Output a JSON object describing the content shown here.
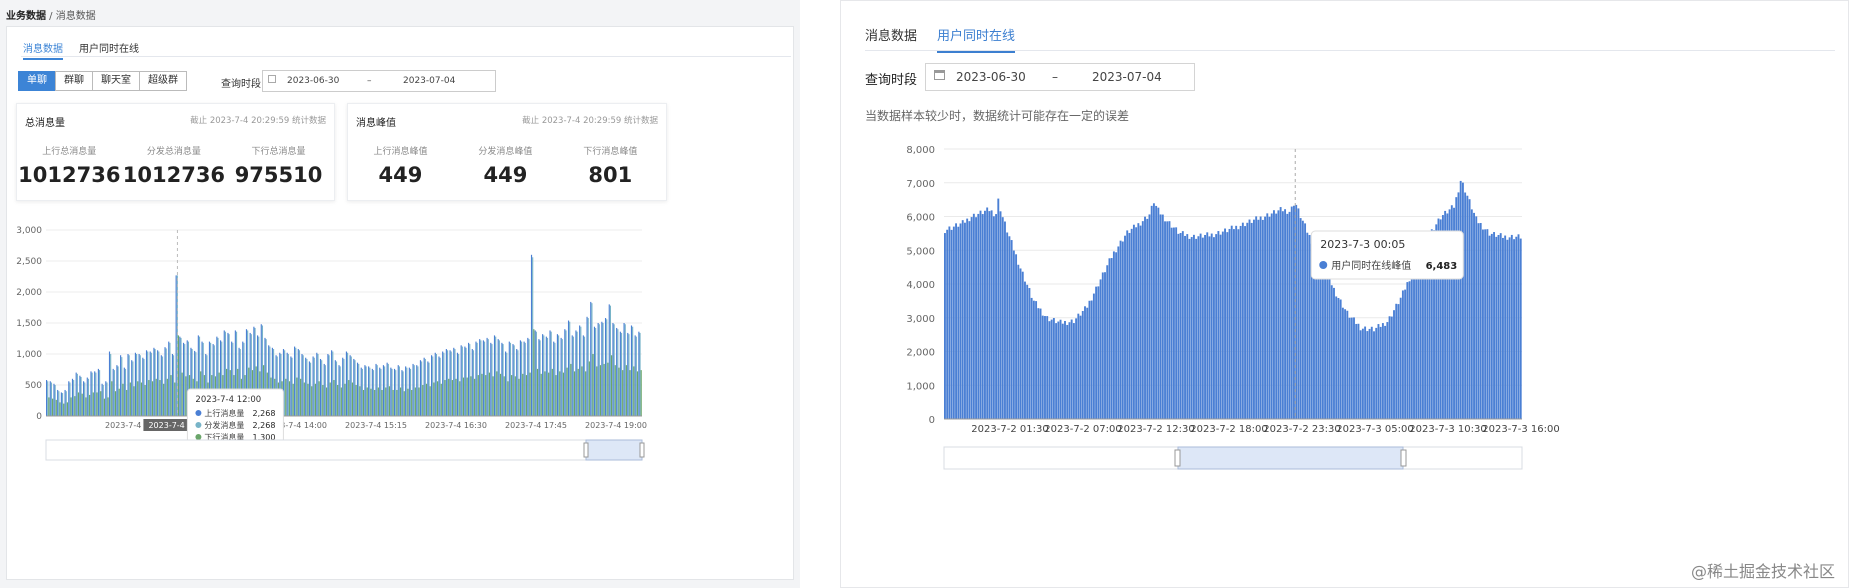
{
  "left": {
    "breadcrumb": {
      "root": "业务数据",
      "sep": " / ",
      "leaf": "消息数据"
    },
    "tabs": [
      "消息数据",
      "用户同时在线"
    ],
    "segments": [
      "单聊",
      "群聊",
      "聊天室",
      "超级群"
    ],
    "query": {
      "label": "查询时段",
      "start": "2023-06-30",
      "dash": "–",
      "end": "2023-07-04"
    },
    "cards": [
      {
        "title": "总消息量",
        "note": "截止 2023-7-4 20:29:59 统计数据",
        "items": [
          {
            "label": "上行总消息量",
            "value": "1012736"
          },
          {
            "label": "分发总消息量",
            "value": "1012736"
          },
          {
            "label": "下行总消息量",
            "value": "975510"
          }
        ]
      },
      {
        "title": "消息峰值",
        "note": "截止 2023-7-4 20:29:59 统计数据",
        "items": [
          {
            "label": "上行消息峰值",
            "value": "449"
          },
          {
            "label": "分发消息峰值",
            "value": "449"
          },
          {
            "label": "下行消息峰值",
            "value": "801"
          }
        ]
      }
    ],
    "tooltip": {
      "title": "2023-7-4 12:00",
      "rows": [
        {
          "name": "上行消息量",
          "value": "2,268",
          "color": "#4a7fd4"
        },
        {
          "name": "分发消息量",
          "value": "2,268",
          "color": "#78b4c8"
        },
        {
          "name": "下行消息量",
          "value": "1,300",
          "color": "#6aa56a"
        }
      ]
    },
    "axis_pointer_label": "2023-7-4 12:00"
  },
  "right": {
    "tabs": [
      "消息数据",
      "用户同时在线"
    ],
    "query": {
      "label": "查询时段",
      "start": "2023-06-30",
      "dash": "–",
      "end": "2023-07-04"
    },
    "note": "当数据样本较少时，数据统计可能存在一定的误差",
    "tooltip": {
      "title": "2023-7-3 00:05",
      "name": "用户同时在线峰值",
      "value": "6,483",
      "color": "#4a7fd4"
    }
  },
  "watermark": "@稀土掘金技术社区",
  "chart_data": [
    {
      "type": "bar",
      "legend": [
        "上行消息量",
        "分发消息量",
        "下行消息量"
      ],
      "colors": [
        "#4a7fd4",
        "#78b4c8",
        "#6aa56a"
      ],
      "ylim": [
        0,
        3000
      ],
      "yticks": [
        0,
        500,
        1000,
        1500,
        2000,
        2500,
        3000
      ],
      "ytick_labels": [
        "0",
        "500",
        "1,000",
        "1,500",
        "2,000",
        "2,500",
        "3,000"
      ],
      "xtick_labels": [
        "2023-7-4 10:15",
        "2023-7-4 12:00",
        "2023-7-4 14:00",
        "2023-7-4 15:15",
        "2023-7-4 16:30",
        "2023-7-4 17:45",
        "2023-7-4 19:00"
      ],
      "values": [
        580,
        560,
        520,
        420,
        380,
        420,
        560,
        600,
        700,
        650,
        560,
        620,
        720,
        720,
        760,
        520,
        560,
        1040,
        760,
        820,
        980,
        780,
        1000,
        900,
        1020,
        1000,
        940,
        1060,
        1040,
        1100,
        1060,
        980,
        1110,
        1200,
        1000,
        2268,
        1280,
        1180,
        1220,
        1100,
        1050,
        1300,
        1200,
        1000,
        1200,
        1160,
        1280,
        1220,
        1380,
        1340,
        1200,
        1380,
        1100,
        1200,
        1400,
        1340,
        1440,
        1300,
        1480,
        1260,
        1140,
        1100,
        980,
        1020,
        1080,
        1020,
        960,
        1120,
        1080,
        1000,
        940,
        880,
        960,
        1020,
        920,
        840,
        1000,
        1060,
        900,
        820,
        940,
        1040,
        980,
        920,
        860,
        780,
        820,
        800,
        760,
        840,
        780,
        820,
        860,
        780,
        760,
        820,
        740,
        800,
        780,
        840,
        820,
        900,
        940,
        880,
        980,
        1020,
        960,
        1040,
        1080,
        1060,
        1100,
        1020,
        1140,
        1120,
        1180,
        1080,
        1200,
        1240,
        1220,
        1260,
        1180,
        1300,
        1240,
        1180,
        1040,
        1200,
        1160,
        1080,
        1220,
        1200,
        1260,
        2600,
        1380,
        1240,
        1320,
        1280,
        1380,
        1200,
        1320,
        1260,
        1400,
        1540,
        1300,
        1380,
        1460,
        1300,
        1600,
        1840,
        1440,
        1500,
        1520,
        1580,
        1800,
        1500,
        1420,
        1360,
        1500,
        1340,
        1460,
        1300,
        1360
      ],
      "values2": [
        560,
        540,
        500,
        400,
        370,
        400,
        540,
        580,
        680,
        630,
        540,
        600,
        700,
        700,
        740,
        500,
        540,
        1000,
        740,
        800,
        950,
        760,
        980,
        880,
        1000,
        980,
        920,
        1040,
        1020,
        1080,
        1040,
        960,
        1090,
        1180,
        980,
        2268,
        1260,
        1160,
        1200,
        1080,
        1030,
        1280,
        1180,
        980,
        1180,
        1140,
        1260,
        1200,
        1360,
        1320,
        1180,
        1360,
        1080,
        1180,
        1380,
        1320,
        1420,
        1280,
        1460,
        1240,
        1120,
        1080,
        960,
        1000,
        1060,
        1000,
        940,
        1100,
        1060,
        980,
        920,
        860,
        940,
        1000,
        900,
        820,
        980,
        1040,
        880,
        800,
        920,
        1020,
        960,
        900,
        840,
        760,
        800,
        780,
        740,
        820,
        760,
        800,
        840,
        760,
        740,
        800,
        720,
        780,
        760,
        820,
        800,
        880,
        920,
        860,
        960,
        1000,
        940,
        1020,
        1060,
        1040,
        1080,
        1000,
        1120,
        1100,
        1160,
        1060,
        1180,
        1220,
        1200,
        1240,
        1160,
        1280,
        1220,
        1160,
        1020,
        1180,
        1140,
        1060,
        1200,
        1180,
        1240,
        2560,
        1360,
        1220,
        1300,
        1260,
        1360,
        1180,
        1300,
        1240,
        1380,
        1520,
        1280,
        1360,
        1440,
        1280,
        1580,
        1820,
        1420,
        1480,
        1500,
        1560,
        1780,
        1480,
        1400,
        1340,
        1480,
        1320,
        1440,
        1280,
        1340
      ],
      "values3": [
        300,
        280,
        260,
        220,
        200,
        220,
        300,
        320,
        380,
        360,
        300,
        340,
        380,
        380,
        400,
        280,
        300,
        560,
        400,
        440,
        520,
        420,
        540,
        480,
        560,
        540,
        500,
        580,
        560,
        600,
        580,
        520,
        600,
        660,
        540,
        1300,
        700,
        640,
        660,
        600,
        560,
        720,
        660,
        540,
        660,
        640,
        700,
        660,
        760,
        740,
        660,
        760,
        600,
        660,
        780,
        740,
        800,
        720,
        820,
        700,
        620,
        600,
        540,
        560,
        600,
        560,
        520,
        620,
        600,
        540,
        520,
        480,
        520,
        560,
        500,
        460,
        540,
        580,
        500,
        460,
        520,
        580,
        540,
        500,
        480,
        420,
        460,
        440,
        420,
        460,
        420,
        460,
        480,
        420,
        420,
        460,
        400,
        440,
        420,
        460,
        460,
        500,
        520,
        480,
        540,
        560,
        520,
        580,
        600,
        580,
        600,
        560,
        620,
        620,
        640,
        600,
        660,
        680,
        660,
        700,
        640,
        720,
        680,
        640,
        560,
        660,
        640,
        600,
        680,
        660,
        700,
        1400,
        760,
        680,
        720,
        700,
        760,
        660,
        720,
        700,
        780,
        840,
        720,
        760,
        800,
        720,
        880,
        1000,
        800,
        820,
        840,
        860,
        980,
        820,
        780,
        740,
        820,
        740,
        800,
        720,
        740
      ]
    },
    {
      "type": "bar",
      "legend": [
        "用户同时在线峰值"
      ],
      "colors": [
        "#4a7fd4"
      ],
      "ylim": [
        0,
        8000
      ],
      "yticks": [
        0,
        1000,
        2000,
        3000,
        4000,
        5000,
        6000,
        7000,
        8000
      ],
      "ytick_labels": [
        "0",
        "1,000",
        "2,000",
        "3,000",
        "4,000",
        "5,000",
        "6,000",
        "7,000",
        "8,000"
      ],
      "xtick_labels": [
        "2023-7-2 01:30",
        "2023-7-2 07:00",
        "2023-7-2 12:30",
        "2023-7-2 18:00",
        "2023-7-2 23:30",
        "2023-7-3 05:00",
        "2023-7-3 10:30",
        "2023-7-3 16:00"
      ],
      "profile": [
        [
          0,
          5600
        ],
        [
          2,
          5700
        ],
        [
          4,
          5800
        ],
        [
          6,
          6000
        ],
        [
          8,
          6100
        ],
        [
          10,
          6200
        ],
        [
          11.5,
          6050
        ],
        [
          12,
          6500
        ],
        [
          13,
          6000
        ],
        [
          14,
          5600
        ],
        [
          17,
          4500
        ],
        [
          20,
          3500
        ],
        [
          23,
          3000
        ],
        [
          26,
          2850
        ],
        [
          29,
          2900
        ],
        [
          32,
          3300
        ],
        [
          35,
          4100
        ],
        [
          38,
          4900
        ],
        [
          41,
          5500
        ],
        [
          44,
          5800
        ],
        [
          46.5,
          6100
        ],
        [
          47,
          6500
        ],
        [
          48,
          6200
        ],
        [
          50,
          5900
        ],
        [
          53,
          5500
        ],
        [
          56,
          5400
        ],
        [
          60,
          5450
        ],
        [
          64,
          5600
        ],
        [
          68,
          5800
        ],
        [
          72,
          6000
        ],
        [
          76,
          6200
        ],
        [
          78,
          6150
        ],
        [
          79,
          6450
        ],
        [
          80,
          6100
        ],
        [
          82,
          5500
        ],
        [
          85,
          4700
        ],
        [
          88,
          3800
        ],
        [
          91,
          3100
        ],
        [
          94,
          2700
        ],
        [
          97,
          2650
        ],
        [
          100,
          2900
        ],
        [
          103,
          3600
        ],
        [
          106,
          4500
        ],
        [
          109,
          5400
        ],
        [
          112,
          6000
        ],
        [
          115,
          6300
        ],
        [
          116.5,
          7100
        ],
        [
          118,
          6600
        ],
        [
          120,
          5900
        ],
        [
          123,
          5500
        ],
        [
          126,
          5400
        ],
        [
          130,
          5400
        ]
      ]
    }
  ]
}
